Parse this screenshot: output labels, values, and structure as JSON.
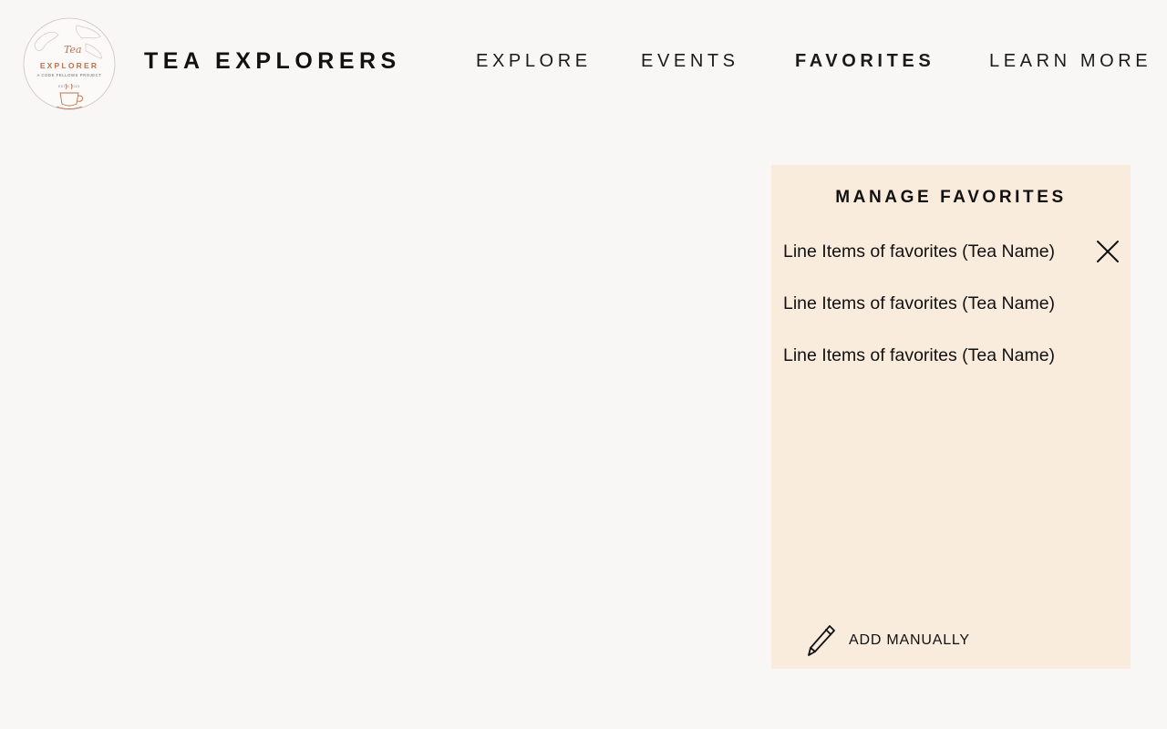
{
  "header": {
    "logo": {
      "script_word": "Tea",
      "name": "EXPLORER",
      "tagline": "A CODE FELLOWS PROJECT",
      "est": "EST'D 2021"
    },
    "title": "TEA EXPLORERS",
    "nav": [
      {
        "label": "EXPLORE",
        "active": false
      },
      {
        "label": "EVENTS",
        "active": false
      },
      {
        "label": "FAVORITES",
        "active": true
      },
      {
        "label": "LEARN MORE",
        "active": false
      }
    ]
  },
  "favorites_panel": {
    "title": "MANAGE FAVORITES",
    "items": [
      {
        "label": "Line Items of favorites (Tea Name)",
        "show_remove": true
      },
      {
        "label": "Line Items of favorites (Tea Name)",
        "show_remove": false
      },
      {
        "label": "Line Items of favorites (Tea Name)",
        "show_remove": false
      }
    ],
    "add_label": "ADD MANUALLY"
  },
  "icons": {
    "remove": "close-icon",
    "add": "pencil-icon"
  },
  "colors": {
    "page_background": "#f9f7f5",
    "panel_background": "#faecdc",
    "logo_accent": "#c0704a",
    "text": "#111111"
  }
}
